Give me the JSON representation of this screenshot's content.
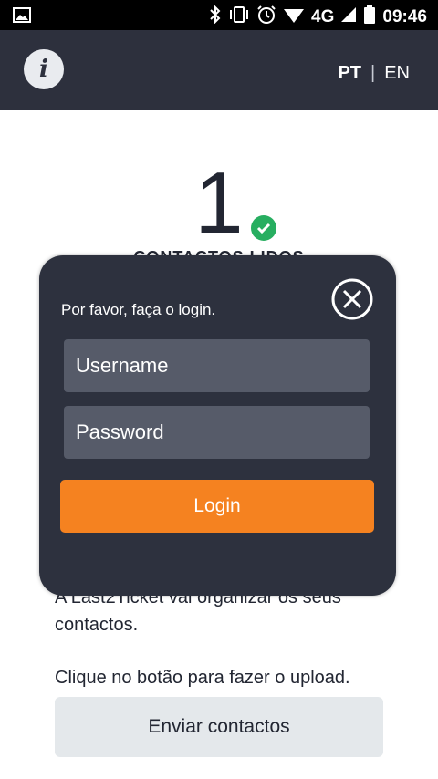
{
  "status_bar": {
    "network": "4G",
    "time": "09:46"
  },
  "header": {
    "info_icon": "i",
    "lang_pt": "PT",
    "lang_separator": "|",
    "lang_en": "EN"
  },
  "main": {
    "count": "1",
    "count_label": "CONTACTOS LIDOS",
    "description": "A Last2Ticket vai organizar os seus contactos.",
    "upload_hint": "Clique no botão para fazer o upload.",
    "send_button": "Enviar contactos"
  },
  "login_modal": {
    "message": "Por favor, faça o login.",
    "username_placeholder": "Username",
    "password_placeholder": "Password",
    "login_button": "Login"
  },
  "colors": {
    "header_bg": "#2d303d",
    "modal_bg": "#2d313e",
    "input_bg": "#565b69",
    "accent": "#f58220",
    "success": "#27ae60"
  }
}
